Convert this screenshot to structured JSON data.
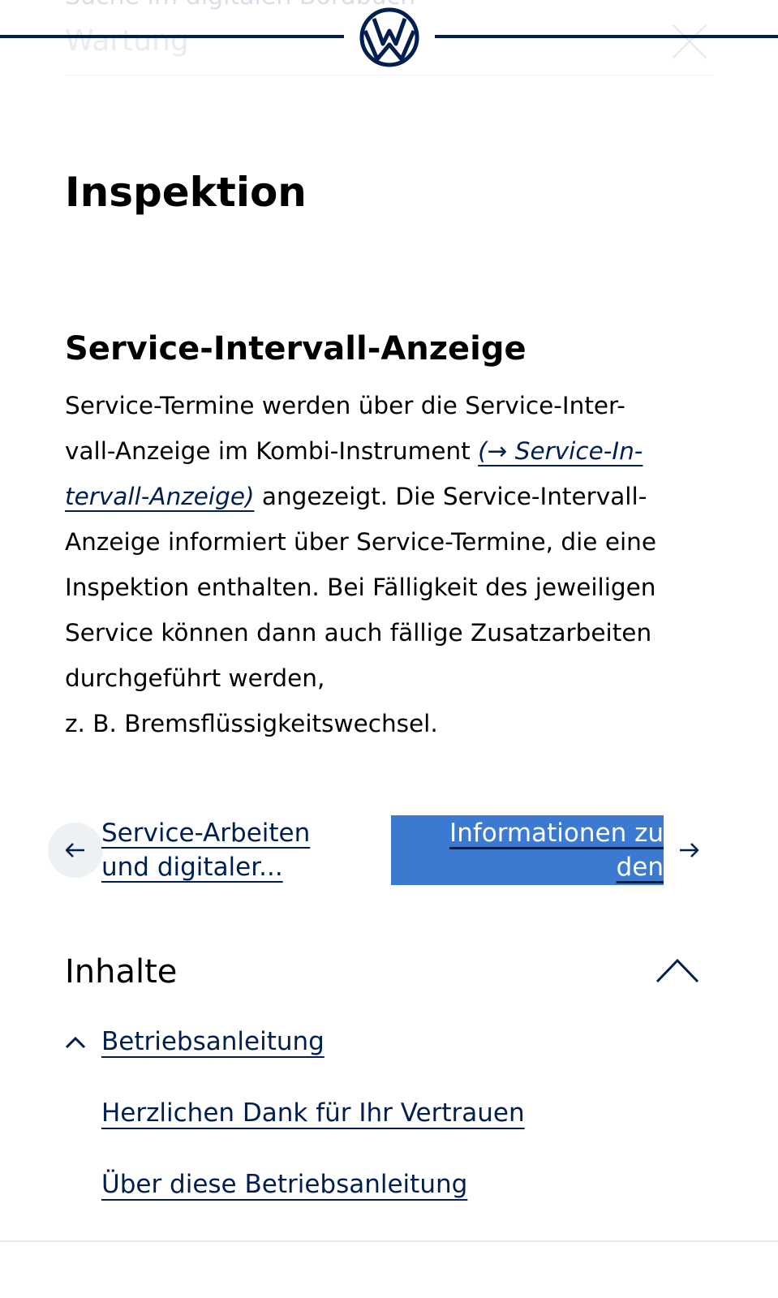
{
  "header": {
    "search_text": "Suche im digitalen Bordbuch",
    "scrolled_title": "Wartung",
    "logo_name": "vw-logo",
    "brand_color": "#001e50"
  },
  "page": {
    "title": "Inspektion"
  },
  "section": {
    "heading": "Service-Intervall-Anzeige",
    "paragraph": {
      "line1": "Service-Termine werden über die Service-Inter-",
      "line2_text": "vall-Anzeige im Kombi-Instrument ",
      "link_part1": "(→ Service-In-",
      "link_part2": "tervall-Anzeige)",
      "line3_text": " angezeigt. Die Service-Intervall-",
      "line4": "Anzeige informiert über Service-Termine, die eine",
      "line5": "Inspektion enthalten. Bei Fälligkeit des jeweiligen",
      "line6": "Service können dann auch fällige Zusatzarbeiten",
      "line7": "durchgeführt werden,",
      "line8": "z. B. Bremsflüssigkeitswechsel."
    }
  },
  "navigation": {
    "prev": {
      "line1": "Service-Arbeiten",
      "line2": "und digitaler..."
    },
    "next": {
      "line1": "Informationen zu",
      "line2": "den",
      "highlight_color": "#3c7ad1"
    }
  },
  "contents": {
    "heading": "Inhalte",
    "toggle_icon": "chevron-up-icon",
    "items": [
      {
        "label": "Betriebsanleitung",
        "expanded": true
      },
      {
        "label": "Herzlichen Dank für Ihr Vertrauen"
      },
      {
        "label": "Über diese Betriebsanleitung"
      }
    ]
  }
}
